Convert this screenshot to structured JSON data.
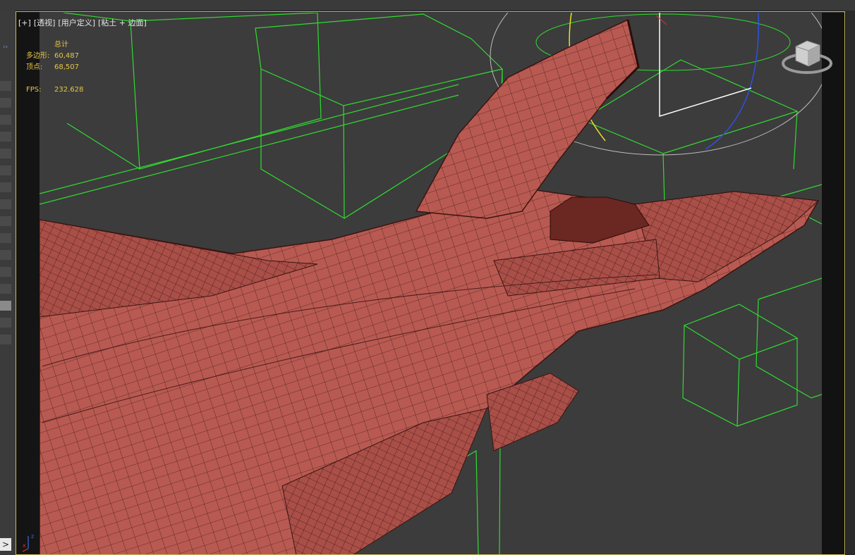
{
  "viewport": {
    "label_parts": [
      "[+]",
      "[透视]",
      "[用户定义]",
      "[粘土 + 边面]"
    ],
    "stats": {
      "header": "总计",
      "rows": [
        {
          "key": "多边形:",
          "value": "60,487"
        },
        {
          "key": "顶点:",
          "value": "68,507"
        }
      ],
      "fps_key": "FPS:",
      "fps_value": "232.628"
    },
    "axis": {
      "x": "x",
      "z": "z"
    }
  },
  "colors": {
    "wireframe": "#2fdc2f",
    "clay": "#b85a52",
    "viewport_bg": "#3c3c3c",
    "active_border": "#c8b85a",
    "stats_text": "#e8c548"
  },
  "icons": {
    "view_cube": "view-cube-icon",
    "axis_gizmo": "axis-gizmo-icon",
    "expand": "double-chevron-icon",
    "play": "play-arrow-icon"
  }
}
